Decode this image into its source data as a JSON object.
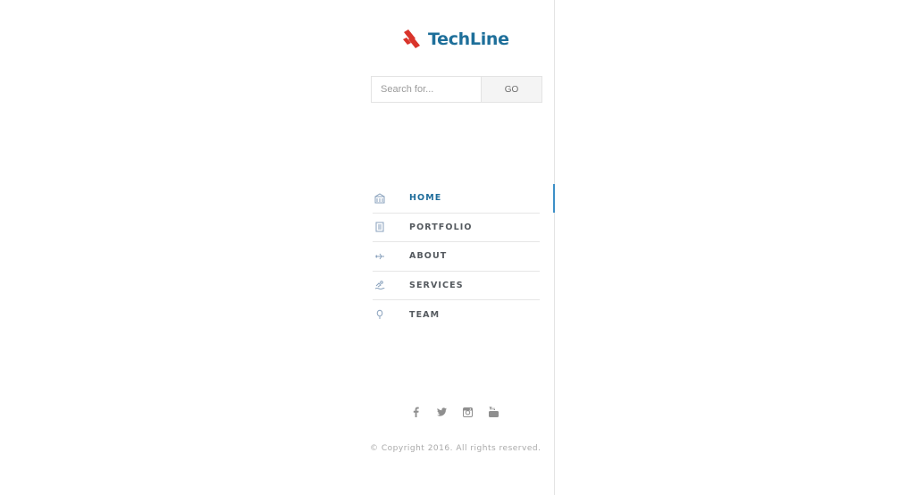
{
  "brand": {
    "name": "TechLine",
    "logo_icon": "logo-stripes-icon",
    "colors": {
      "mark": "#d9342b",
      "text": "#1e6f9a"
    }
  },
  "search": {
    "placeholder": "Search for...",
    "value": "",
    "button_label": "GO"
  },
  "nav": {
    "items": [
      {
        "label": "HOME",
        "icon": "building-icon",
        "active": true
      },
      {
        "label": "PORTFOLIO",
        "icon": "document-icon",
        "active": false
      },
      {
        "label": "ABOUT",
        "icon": "plane-icon",
        "active": false
      },
      {
        "label": "SERVICES",
        "icon": "swimmer-icon",
        "active": false
      },
      {
        "label": "TEAM",
        "icon": "balloon-icon",
        "active": false
      }
    ],
    "accent": "#3d8fc7"
  },
  "social": {
    "icons": [
      "facebook-icon",
      "twitter-icon",
      "instagram-icon",
      "youtube-icon"
    ]
  },
  "footer": {
    "copyright": "© Copyright 2016. All rights reserved."
  }
}
